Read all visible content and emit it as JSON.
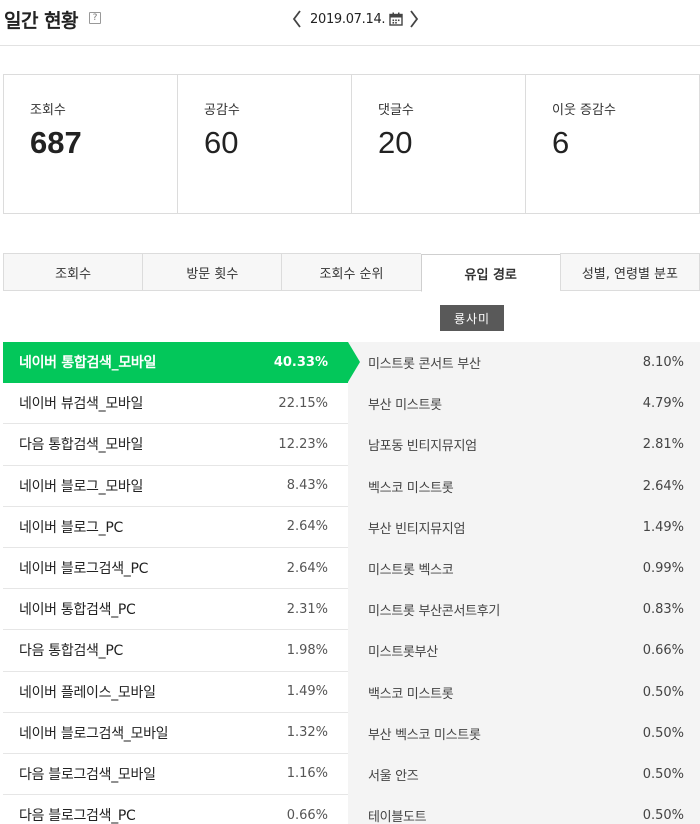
{
  "header": {
    "title": "일간 현황",
    "help_glyph": "?",
    "date": "2019.07.14."
  },
  "stats": [
    {
      "label": "조회수",
      "value": "687"
    },
    {
      "label": "공감수",
      "value": "60"
    },
    {
      "label": "댓글수",
      "value": "20"
    },
    {
      "label": "이웃 증감수",
      "value": "6"
    }
  ],
  "tabs": [
    {
      "label": "조회수"
    },
    {
      "label": "방문 횟수"
    },
    {
      "label": "조회수 순위"
    },
    {
      "label": "유입 경로"
    },
    {
      "label": "성별, 연령별 분포"
    }
  ],
  "active_tab": "유입 경로",
  "watermark": "룡사미",
  "sources": [
    {
      "label": "네이버 통합검색_모바일",
      "pct": "40.33%"
    },
    {
      "label": "네이버 뷰검색_모바일",
      "pct": "22.15%"
    },
    {
      "label": "다음 통합검색_모바일",
      "pct": "12.23%"
    },
    {
      "label": "네이버 블로그_모바일",
      "pct": "8.43%"
    },
    {
      "label": "네이버 블로그_PC",
      "pct": "2.64%"
    },
    {
      "label": "네이버 블로그검색_PC",
      "pct": "2.64%"
    },
    {
      "label": "네이버 통합검색_PC",
      "pct": "2.31%"
    },
    {
      "label": "다음 통합검색_PC",
      "pct": "1.98%"
    },
    {
      "label": "네이버 플레이스_모바일",
      "pct": "1.49%"
    },
    {
      "label": "네이버 블로그검색_모바일",
      "pct": "1.32%"
    },
    {
      "label": "다음 블로그검색_모바일",
      "pct": "1.16%"
    },
    {
      "label": "다음 블로그검색_PC",
      "pct": "0.66%"
    }
  ],
  "keywords": [
    {
      "label": "미스트롯 콘서트 부산",
      "pct": "8.10%"
    },
    {
      "label": "부산 미스트롯",
      "pct": "4.79%"
    },
    {
      "label": "남포동 빈티지뮤지엄",
      "pct": "2.81%"
    },
    {
      "label": "벡스코 미스트롯",
      "pct": "2.64%"
    },
    {
      "label": "부산 빈티지뮤지엄",
      "pct": "1.49%"
    },
    {
      "label": "미스트롯 벡스코",
      "pct": "0.99%"
    },
    {
      "label": "미스트롯 부산콘서트후기",
      "pct": "0.83%"
    },
    {
      "label": "미스트롯부산",
      "pct": "0.66%"
    },
    {
      "label": "백스코 미스트롯",
      "pct": "0.50%"
    },
    {
      "label": "부산 벡스코 미스트롯",
      "pct": "0.50%"
    },
    {
      "label": "서울 안즈",
      "pct": "0.50%"
    },
    {
      "label": "테이블도트",
      "pct": "0.50%"
    }
  ],
  "colors": {
    "accent": "#03c75a",
    "watermark_bg": "#595959",
    "panel_bg": "#f4f4f4"
  },
  "icons": {
    "prev": "chevron-left-icon",
    "next": "chevron-right-icon",
    "calendar": "calendar-icon",
    "help": "help-icon"
  }
}
